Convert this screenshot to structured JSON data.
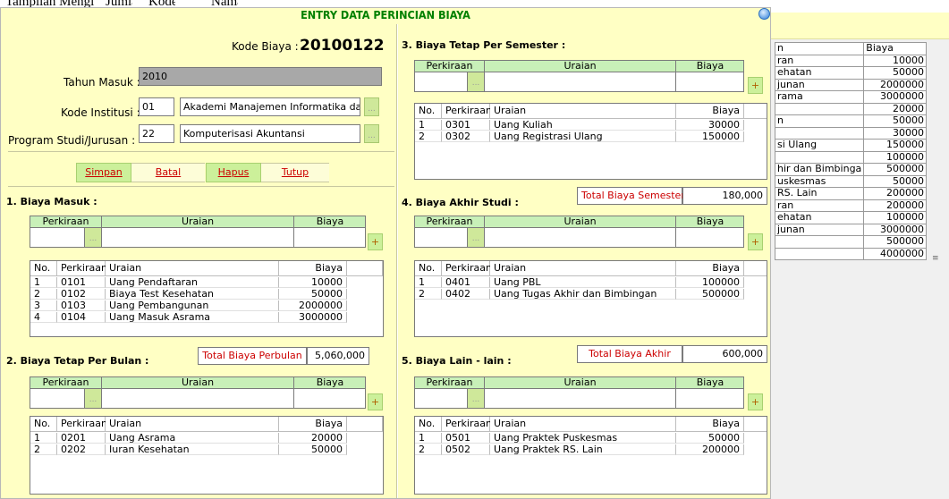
{
  "background": {
    "fragments": [
      "Tampilan Mengi",
      "Jumlah",
      "Kode",
      "Nama"
    ],
    "table_header": [
      "n",
      "Biaya"
    ],
    "table_rows": [
      [
        "ran",
        "10000"
      ],
      [
        "ehatan",
        "50000"
      ],
      [
        "junan",
        "2000000"
      ],
      [
        "rama",
        "3000000"
      ],
      [
        "",
        "20000"
      ],
      [
        "n",
        "50000"
      ],
      [
        "",
        "30000"
      ],
      [
        "si Ulang",
        "150000"
      ],
      [
        "",
        "100000"
      ],
      [
        "hir dan Bimbinga",
        "500000"
      ],
      [
        "uskesmas",
        "50000"
      ],
      [
        "RS. Lain",
        "200000"
      ],
      [
        "ran",
        "200000"
      ],
      [
        "ehatan",
        "100000"
      ],
      [
        "junan",
        "3000000"
      ],
      [
        "",
        "500000"
      ],
      [
        "",
        "4000000"
      ]
    ]
  },
  "dialog": {
    "title": "ENTRY DATA PERINCIAN BIAYA",
    "kode_biaya_label": "Kode Biaya :",
    "kode_biaya_value": "20100122",
    "tahun_masuk_label": "Tahun Masuk :",
    "tahun_masuk_value": "2010",
    "kode_institusi_label": "Kode Institusi :",
    "kode_institusi_code": "01",
    "kode_institusi_name": "Akademi Manajemen Informatika dan",
    "program_studi_label": "Program Studi/Jurusan :",
    "program_studi_code": "22",
    "program_studi_name": "Komputerisasi Akuntansi",
    "browse_label": "...",
    "add_label": "+",
    "buttons": {
      "simpan": "Simpan",
      "batal": "Batal",
      "hapus": "Hapus",
      "tutup": "Tutup"
    }
  },
  "entry_headers": {
    "perkiraan": "Perkiraan",
    "uraian": "Uraian",
    "biaya": "Biaya"
  },
  "grid_headers": {
    "no": "No.",
    "perkiraan": "Perkiraan",
    "uraian": "Uraian",
    "biaya": "Biaya"
  },
  "sections": {
    "biaya_masuk": {
      "title": "1. Biaya Masuk :",
      "rows": [
        [
          "1",
          "0101",
          "Uang Pendaftaran",
          "10000"
        ],
        [
          "2",
          "0102",
          "Biaya Test Kesehatan",
          "50000"
        ],
        [
          "3",
          "0103",
          "Uang Pembangunan",
          "2000000"
        ],
        [
          "4",
          "0104",
          "Uang Masuk Asrama",
          "3000000"
        ]
      ]
    },
    "biaya_perbulan": {
      "title": "2. Biaya Tetap Per Bulan :",
      "total_label": "Total Biaya Perbulan",
      "total_value": "5,060,000",
      "rows": [
        [
          "1",
          "0201",
          "Uang Asrama",
          "20000"
        ],
        [
          "2",
          "0202",
          "Iuran Kesehatan",
          "50000"
        ]
      ]
    },
    "biaya_semester": {
      "title": "3. Biaya Tetap Per Semester :",
      "total_label": "Total Biaya Semester",
      "total_value": "180,000",
      "rows": [
        [
          "1",
          "0301",
          "Uang Kuliah",
          "30000"
        ],
        [
          "2",
          "0302",
          "Uang Registrasi Ulang",
          "150000"
        ]
      ]
    },
    "biaya_akhir": {
      "title": "4. Biaya Akhir Studi :",
      "total_label": "Total Biaya Akhir",
      "total_value": "600,000",
      "rows": [
        [
          "1",
          "0401",
          "Uang PBL",
          "100000"
        ],
        [
          "2",
          "0402",
          "Uang Tugas Akhir dan Bimbingan",
          "500000"
        ]
      ]
    },
    "biaya_lain": {
      "title": "5. Biaya Lain - lain :",
      "rows": [
        [
          "1",
          "0501",
          "Uang Praktek Puskesmas",
          "50000"
        ],
        [
          "2",
          "0502",
          "Uang Praktek RS. Lain",
          "200000"
        ]
      ]
    }
  }
}
